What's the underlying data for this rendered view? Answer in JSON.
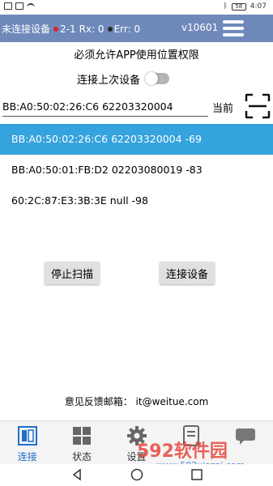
{
  "statusbar": {
    "battery": "58",
    "time": "4:07"
  },
  "header": {
    "connection_status": "未连接设备",
    "counter": "2-1",
    "rx": "Rx: 0",
    "err": "Err: 0",
    "version": "v10601",
    "menu_icon": "hamburger-menu-icon"
  },
  "notice": "必须允许APP使用位置权限",
  "reconnect": {
    "label": "连接上次设备",
    "enabled": false
  },
  "device_input": {
    "value": "BB:A0:50:02:26:C6 62203320004"
  },
  "current_label": "当前",
  "scan_icon": "scan-frame-icon",
  "devices": [
    {
      "text": "BB:A0:50:02:26:C6 62203320004 -69",
      "selected": true
    },
    {
      "text": "BB:A0:50:01:FB:D2 02203080019 -83",
      "selected": false
    },
    {
      "text": "60:2C:87:E3:3B:3E null -98",
      "selected": false
    }
  ],
  "buttons": {
    "stop_scan": "停止扫描",
    "connect_device": "连接设备"
  },
  "feedback": "意见反馈邮箱：  it@weitue.com",
  "tabs": [
    {
      "label": "连接",
      "icon": "connect-icon",
      "active": true
    },
    {
      "label": "状态",
      "icon": "status-grid-icon",
      "active": false
    },
    {
      "label": "设置",
      "icon": "gear-icon",
      "active": false
    },
    {
      "label": "",
      "icon": "device-icon",
      "active": false
    },
    {
      "label": "",
      "icon": "message-icon",
      "active": false
    }
  ],
  "watermark": {
    "brand": "592软件园",
    "url": "www.592xiazai.com"
  },
  "colors": {
    "header_bg": "#6f89ba",
    "selected_row": "#35a3de",
    "active_tab": "#1f6fc9",
    "status_dot_red": "#e0202a"
  }
}
